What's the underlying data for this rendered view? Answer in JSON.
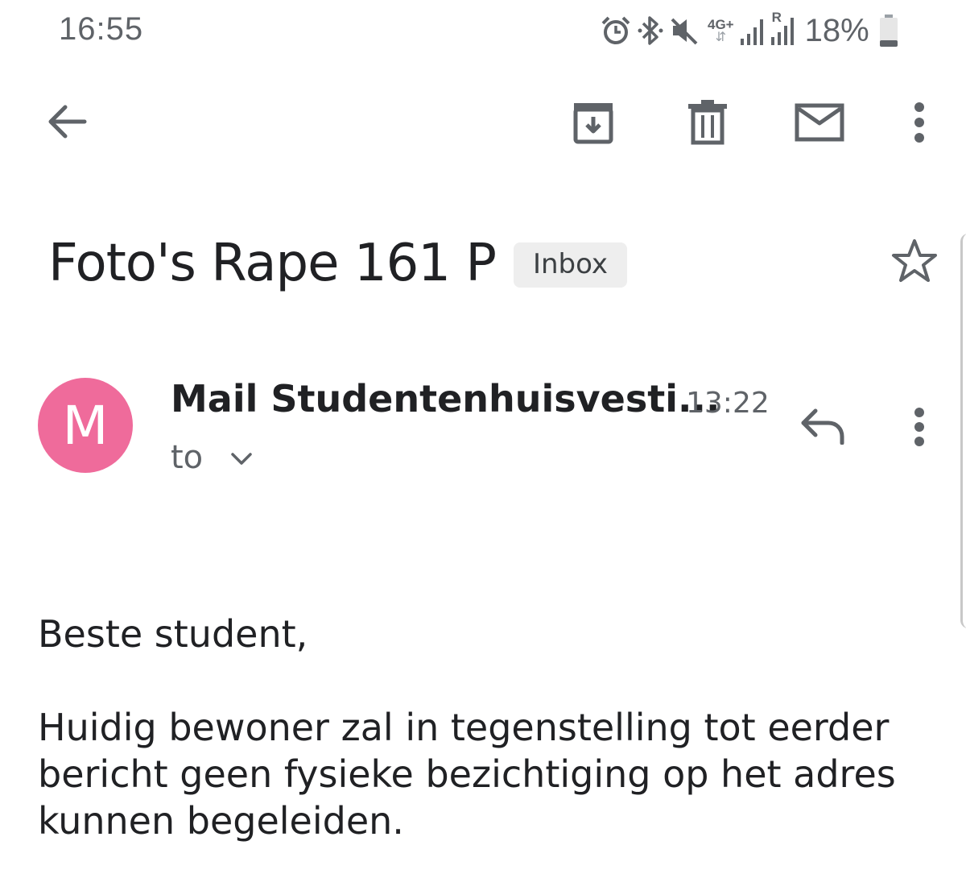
{
  "status_bar": {
    "time": "16:55",
    "network_label": "4G+",
    "roaming_label": "R",
    "battery_percent": "18%",
    "icons": [
      "alarm-icon",
      "bluetooth-icon",
      "mute-icon",
      "network-4g-icon",
      "signal-icon",
      "signal-roaming-icon",
      "battery-icon"
    ]
  },
  "toolbar": {
    "back": "back-arrow-icon",
    "archive": "archive-icon",
    "delete": "trash-icon",
    "mark_unread": "mail-icon",
    "more": "more-vert-icon"
  },
  "email": {
    "subject": "Foto's Rape 161 P",
    "label": "Inbox",
    "sender_initial": "M",
    "avatar_color": "#ef6b9b",
    "sender_name": "Mail Studentenhuisvesti...",
    "time": "13:22",
    "recipients_label": "to",
    "greeting": "Beste student,",
    "body_lines": [
      "Huidig bewoner zal in tegenstelling tot eerder",
      "bericht geen fysieke bezichtiging op het adres",
      "kunnen begeleiden."
    ]
  }
}
